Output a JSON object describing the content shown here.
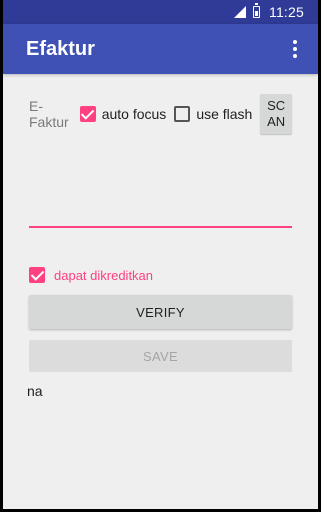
{
  "status_bar": {
    "time": "11:25",
    "icons": [
      "signal-icon",
      "sim-icon",
      "battery-icon"
    ]
  },
  "app_bar": {
    "title": "Efaktur",
    "menu_icon": "more-vert-icon"
  },
  "form": {
    "efaktur_label": "E-Faktur",
    "auto_focus": {
      "label": "auto focus",
      "checked": true
    },
    "use_flash": {
      "label": "use flash",
      "checked": false
    },
    "scan_button_label": "SC AN",
    "input_value": "",
    "dapat_dikreditkan": {
      "label": "dapat dikreditkan",
      "checked": true
    },
    "verify_label": "VERIFY",
    "save_label": "SAVE",
    "result_text": "na"
  },
  "colors": {
    "status_bar": "#2f3b97",
    "app_bar": "#3f51b5",
    "accent": "#ff4081",
    "background": "#efefef"
  }
}
